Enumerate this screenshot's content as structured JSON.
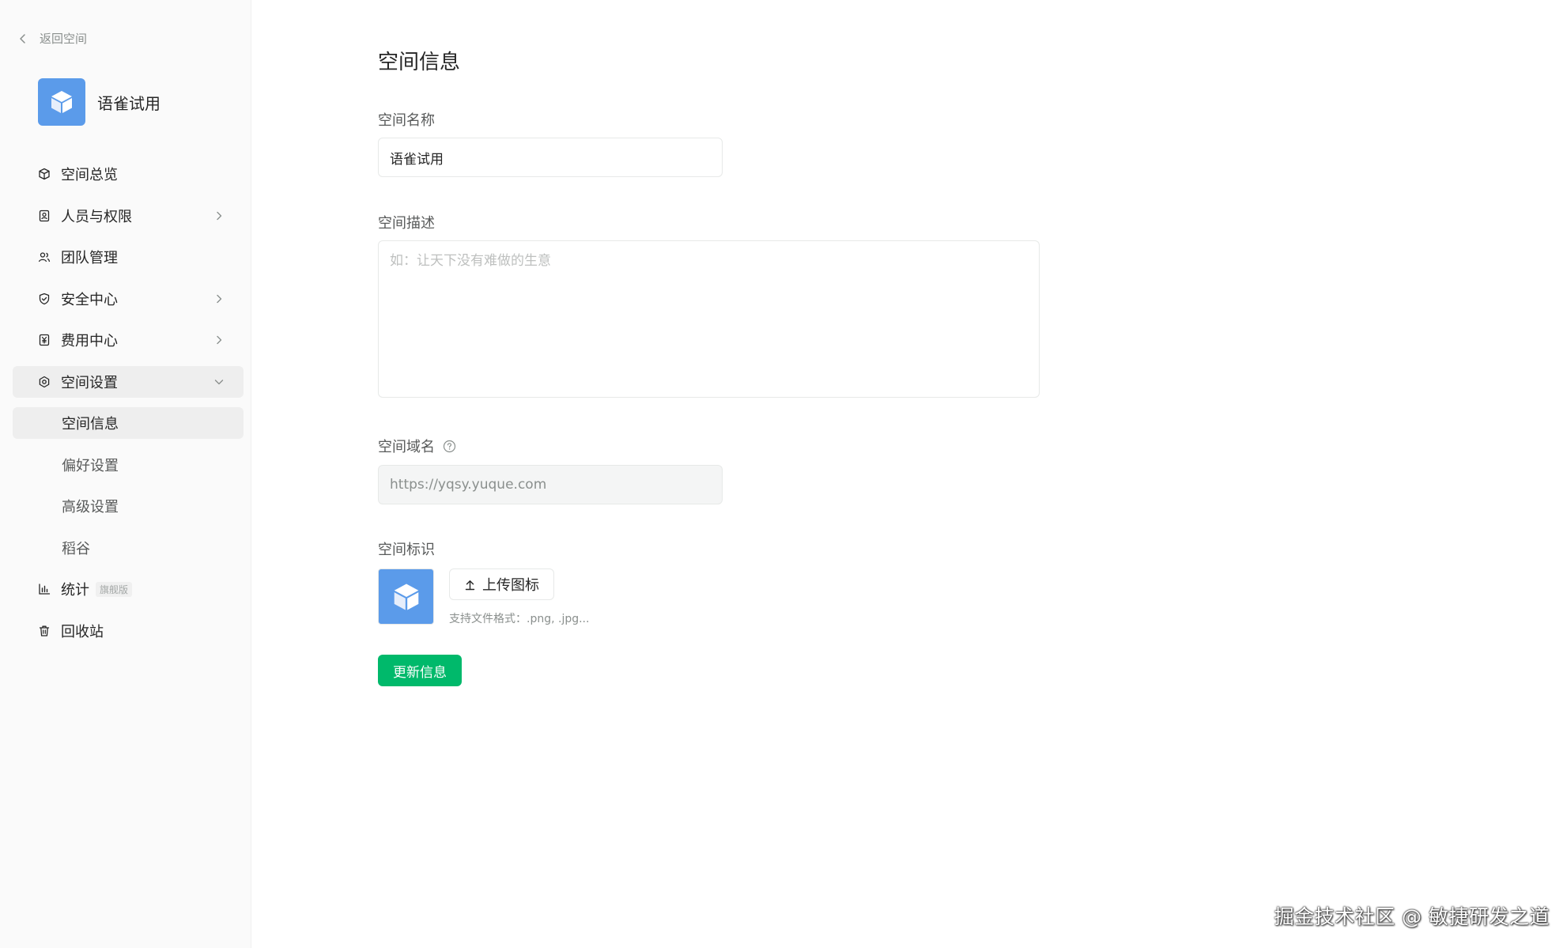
{
  "sidebar": {
    "back_label": "返回空间",
    "space_name": "语雀试用",
    "items": [
      {
        "label": "空间总览",
        "icon": "cube-icon"
      },
      {
        "label": "人员与权限",
        "icon": "person-badge-icon"
      },
      {
        "label": "团队管理",
        "icon": "team-icon"
      },
      {
        "label": "安全中心",
        "icon": "shield-icon"
      },
      {
        "label": "费用中心",
        "icon": "yen-icon"
      },
      {
        "label": "空间设置",
        "icon": "gear-icon"
      }
    ],
    "sub_items": [
      {
        "label": "空间信息"
      },
      {
        "label": "偏好设置"
      },
      {
        "label": "高级设置"
      },
      {
        "label": "稻谷"
      }
    ],
    "stats_label": "统计",
    "stats_badge": "旗舰版",
    "trash_label": "回收站"
  },
  "main": {
    "title": "空间信息",
    "name_label": "空间名称",
    "name_value": "语雀试用",
    "desc_label": "空间描述",
    "desc_placeholder": "如：让天下没有难做的生意",
    "domain_label": "空间域名",
    "domain_value": "https://yqsy.yuque.com",
    "identity_label": "空间标识",
    "upload_label": "上传图标",
    "upload_hint": "支持文件格式：.png, .jpg...",
    "submit_label": "更新信息"
  },
  "watermark": "掘金技术社区 @ 敏捷研发之道",
  "colors": {
    "accent": "#00b96b",
    "logo_blue": "#5b9bea",
    "sidebar_bg": "#fafafa",
    "active_bg": "#eeeeee"
  }
}
